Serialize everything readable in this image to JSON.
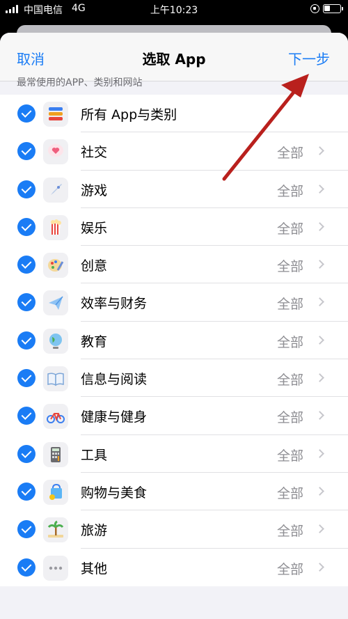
{
  "status_bar": {
    "carrier": "中国电信",
    "network": "4G",
    "time": "上午10:23"
  },
  "navbar": {
    "cancel_label": "取消",
    "title": "选取 App",
    "next_label": "下一步"
  },
  "section_header": "最常使用的APP、类别和网站",
  "colors": {
    "accent": "#1a7cf5",
    "annotation_arrow": "#c0201c"
  },
  "rows": [
    {
      "label": "所有 App与类别",
      "value": "",
      "icon": "stack-layers-icon"
    },
    {
      "label": "社交",
      "value": "全部",
      "icon": "chat-heart-icon"
    },
    {
      "label": "游戏",
      "value": "全部",
      "icon": "rocket-icon"
    },
    {
      "label": "娱乐",
      "value": "全部",
      "icon": "popcorn-icon"
    },
    {
      "label": "创意",
      "value": "全部",
      "icon": "palette-icon"
    },
    {
      "label": "效率与财务",
      "value": "全部",
      "icon": "paper-plane-icon"
    },
    {
      "label": "教育",
      "value": "全部",
      "icon": "globe-icon"
    },
    {
      "label": "信息与阅读",
      "value": "全部",
      "icon": "book-icon"
    },
    {
      "label": "健康与健身",
      "value": "全部",
      "icon": "bicycle-icon"
    },
    {
      "label": "工具",
      "value": "全部",
      "icon": "calculator-icon"
    },
    {
      "label": "购物与美食",
      "value": "全部",
      "icon": "shopping-bag-icon"
    },
    {
      "label": "旅游",
      "value": "全部",
      "icon": "palm-tree-icon"
    },
    {
      "label": "其他",
      "value": "全部",
      "icon": "ellipsis-icon"
    }
  ]
}
